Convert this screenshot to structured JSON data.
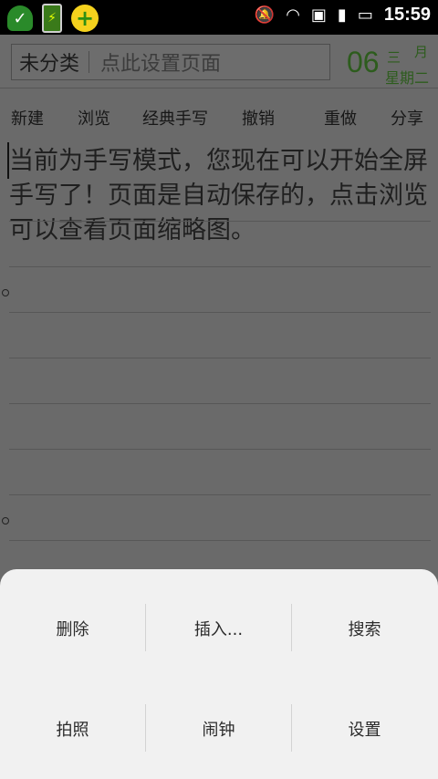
{
  "status_bar": {
    "icons": [
      "shield-add-icon",
      "battery-app-icon",
      "plus-icon",
      "silent-icon",
      "wifi-icon",
      "notification-icon",
      "signal-icon",
      "battery-icon"
    ],
    "time": "15:59"
  },
  "header": {
    "category": "未分类",
    "page_hint": "点此设置页面",
    "day": "06",
    "month": "三",
    "month_unit": "月",
    "weekday": "星期二"
  },
  "toolbar": {
    "items": [
      {
        "label": "新建"
      },
      {
        "label": "浏览"
      },
      {
        "label": "经典手写"
      },
      {
        "label": "撤销"
      },
      {
        "label": "重做"
      },
      {
        "label": "分享"
      }
    ]
  },
  "editor": {
    "text": "当前为手写模式，您现在可以开始全屏手写了！页面是自动保存的，点击浏览可以查看页面缩略图。"
  },
  "menu": {
    "items": [
      {
        "label": "删除"
      },
      {
        "label": "插入..."
      },
      {
        "label": "搜索"
      },
      {
        "label": "拍照"
      },
      {
        "label": "闹钟"
      },
      {
        "label": "设置"
      }
    ]
  },
  "colors": {
    "date_green": "#2d5c1d",
    "menu_bg": "#f1f1f1",
    "overlay_gray": "#6a6a6a"
  }
}
